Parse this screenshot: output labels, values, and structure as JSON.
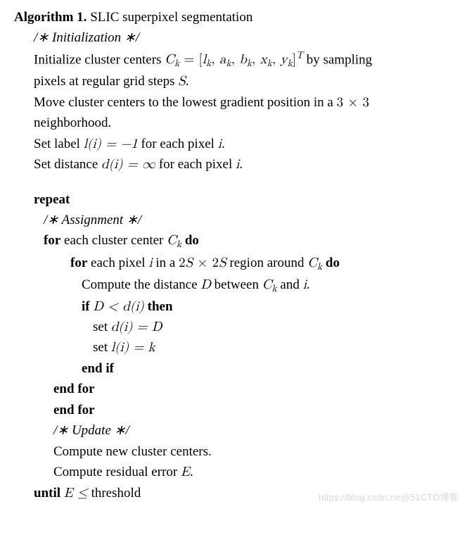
{
  "header": {
    "algo_label": "Algorithm 1.",
    "title": " SLIC superpixel segmentation"
  },
  "init": {
    "comment": "/∗ Initialization ∗/",
    "l1a": "Initialize cluster centers ",
    "l1b": " by sampling",
    "l2": "pixels at regular grid steps ",
    "l2v": "S",
    "l2c": ".",
    "l3a": "Move cluster centers to the lowest gradient position in a ",
    "l3m": "3 × 3",
    "l4": "neighborhood.",
    "l5a": "Set label ",
    "l5b": " for each pixel ",
    "l5c": "i",
    "l5d": ".",
    "l6a": "Set distance ",
    "l6b": " for each pixel ",
    "l6c": "i",
    "l6d": "."
  },
  "loop": {
    "repeat": "repeat",
    "assign_comment": "/∗ Assignment ∗/",
    "for1a": "for",
    "for1b": " each cluster center ",
    "for1c": " do",
    "for2a": "for",
    "for2b": " each pixel ",
    "for2bv": "i",
    "for2c": " in a ",
    "for2m": "2S × 2S",
    "for2d": " region around ",
    "for2e": " do",
    "comp_a": "Compute the distance ",
    "comp_v": "D",
    "comp_b": " between ",
    "comp_c": " and ",
    "comp_d": "i",
    "comp_e": ".",
    "if_a": "if ",
    "if_b": " then",
    "set1": "set ",
    "set2": "set ",
    "endif": "end if",
    "endfor1": "end for",
    "endfor2": "end for",
    "upd_comment": "/∗ Update ∗/",
    "upd1": "Compute new cluster centers.",
    "upd2a": "Compute residual error ",
    "upd2v": "E",
    "upd2b": ".",
    "until_a": "until",
    "until_b": " ",
    "until_c": " threshold"
  },
  "math": {
    "Ck_eq": "C",
    "k": "k",
    "eq": " = [",
    "lab": "l",
    "a": "a",
    "b": "b",
    "x": "x",
    "y": "y",
    "close": "]",
    "T": "T",
    "l_of_i": "l(i) = −1",
    "d_of_i": "d(i) = ∞",
    "D_lt": "D < d(i)",
    "set_d": "d(i) = D",
    "set_l": "l(i) = k",
    "E_le": "E ≤"
  },
  "watermark": "https://blog.csdn.ne@51CTO博客"
}
